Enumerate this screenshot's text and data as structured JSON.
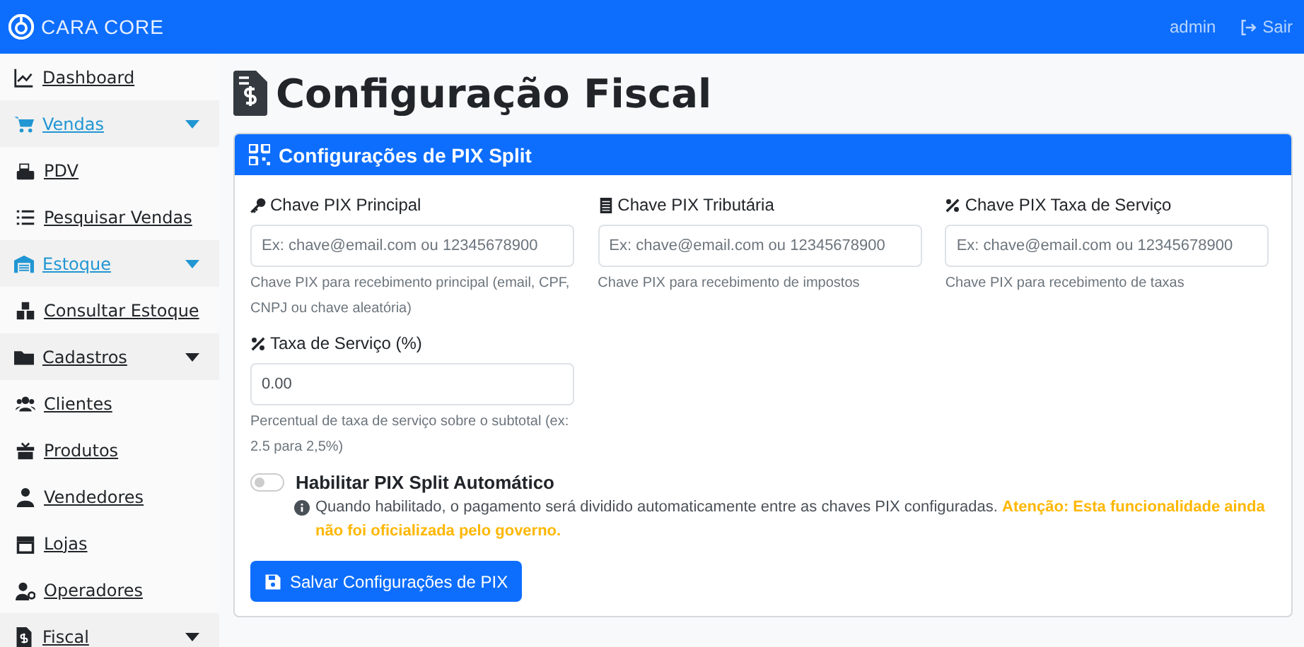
{
  "navbar": {
    "brand": "CARA CORE",
    "user": "admin",
    "logout": "Sair"
  },
  "sidebar": {
    "items": [
      {
        "kind": "link",
        "label": "Dashboard"
      },
      {
        "kind": "group",
        "label": "Vendas",
        "active": true
      },
      {
        "kind": "link",
        "label": "PDV"
      },
      {
        "kind": "link",
        "label": "Pesquisar Vendas"
      },
      {
        "kind": "group",
        "label": "Estoque",
        "active": true
      },
      {
        "kind": "link",
        "label": "Consultar Estoque"
      },
      {
        "kind": "group",
        "label": "Cadastros",
        "active": false
      },
      {
        "kind": "link",
        "label": "Clientes"
      },
      {
        "kind": "link",
        "label": "Produtos"
      },
      {
        "kind": "link",
        "label": "Vendedores"
      },
      {
        "kind": "link",
        "label": "Lojas"
      },
      {
        "kind": "link",
        "label": "Operadores"
      },
      {
        "kind": "group",
        "label": "Fiscal",
        "active": false
      }
    ]
  },
  "page_title": "Configuração Fiscal",
  "card": {
    "title": "Configurações de PIX Split",
    "fields": [
      {
        "label": "Chave PIX Principal",
        "placeholder": "Ex: chave@email.com ou 12345678900",
        "help": "Chave PIX para recebimento principal (email, CPF, CNPJ ou chave aleatória)"
      },
      {
        "label": "Chave PIX Tributária",
        "placeholder": "Ex: chave@email.com ou 12345678900",
        "help": "Chave PIX para recebimento de impostos"
      },
      {
        "label": "Chave PIX Taxa de Serviço",
        "placeholder": "Ex: chave@email.com ou 12345678900",
        "help": "Chave PIX para recebimento de taxas"
      },
      {
        "label": "Taxa de Serviço (%)",
        "value": "0.00",
        "help": "Percentual de taxa de serviço sobre o subtotal (ex: 2.5 para 2,5%)"
      }
    ],
    "toggle": {
      "label": "Habilitar PIX Split Automático",
      "on": false
    },
    "note": "Quando habilitado, o pagamento será dividido automaticamente entre as chaves PIX configuradas.",
    "warning": "Atenção: Esta funcionalidade ainda não foi oficializada pelo governo.",
    "save_button": "Salvar Configurações de PIX"
  }
}
